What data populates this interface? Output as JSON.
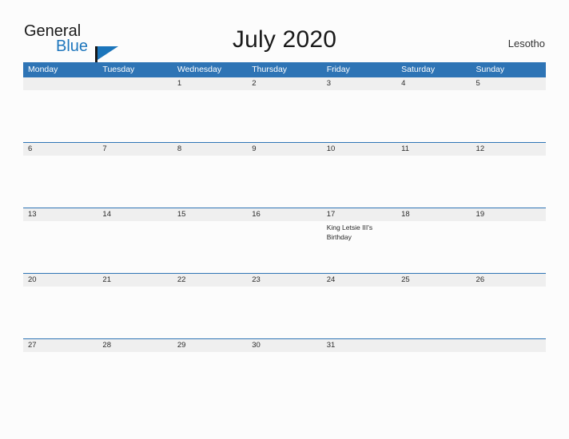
{
  "brand": {
    "word_one": "General",
    "word_two": "Blue",
    "flag_icon": "flag-icon",
    "accent_color": "#1b75bb"
  },
  "header": {
    "title": "July 2020",
    "country": "Lesotho"
  },
  "calendar": {
    "header_color": "#2e74b5",
    "number_band_color": "#efefef",
    "weekdays": [
      "Monday",
      "Tuesday",
      "Wednesday",
      "Thursday",
      "Friday",
      "Saturday",
      "Sunday"
    ],
    "weeks": [
      {
        "days": [
          {
            "num": "",
            "event": ""
          },
          {
            "num": "",
            "event": ""
          },
          {
            "num": "1",
            "event": ""
          },
          {
            "num": "2",
            "event": ""
          },
          {
            "num": "3",
            "event": ""
          },
          {
            "num": "4",
            "event": ""
          },
          {
            "num": "5",
            "event": ""
          }
        ]
      },
      {
        "days": [
          {
            "num": "6",
            "event": ""
          },
          {
            "num": "7",
            "event": ""
          },
          {
            "num": "8",
            "event": ""
          },
          {
            "num": "9",
            "event": ""
          },
          {
            "num": "10",
            "event": ""
          },
          {
            "num": "11",
            "event": ""
          },
          {
            "num": "12",
            "event": ""
          }
        ]
      },
      {
        "days": [
          {
            "num": "13",
            "event": ""
          },
          {
            "num": "14",
            "event": ""
          },
          {
            "num": "15",
            "event": ""
          },
          {
            "num": "16",
            "event": ""
          },
          {
            "num": "17",
            "event": "King Letsie III's Birthday"
          },
          {
            "num": "18",
            "event": ""
          },
          {
            "num": "19",
            "event": ""
          }
        ]
      },
      {
        "days": [
          {
            "num": "20",
            "event": ""
          },
          {
            "num": "21",
            "event": ""
          },
          {
            "num": "22",
            "event": ""
          },
          {
            "num": "23",
            "event": ""
          },
          {
            "num": "24",
            "event": ""
          },
          {
            "num": "25",
            "event": ""
          },
          {
            "num": "26",
            "event": ""
          }
        ]
      },
      {
        "days": [
          {
            "num": "27",
            "event": ""
          },
          {
            "num": "28",
            "event": ""
          },
          {
            "num": "29",
            "event": ""
          },
          {
            "num": "30",
            "event": ""
          },
          {
            "num": "31",
            "event": ""
          },
          {
            "num": "",
            "event": ""
          },
          {
            "num": "",
            "event": ""
          }
        ]
      }
    ]
  }
}
